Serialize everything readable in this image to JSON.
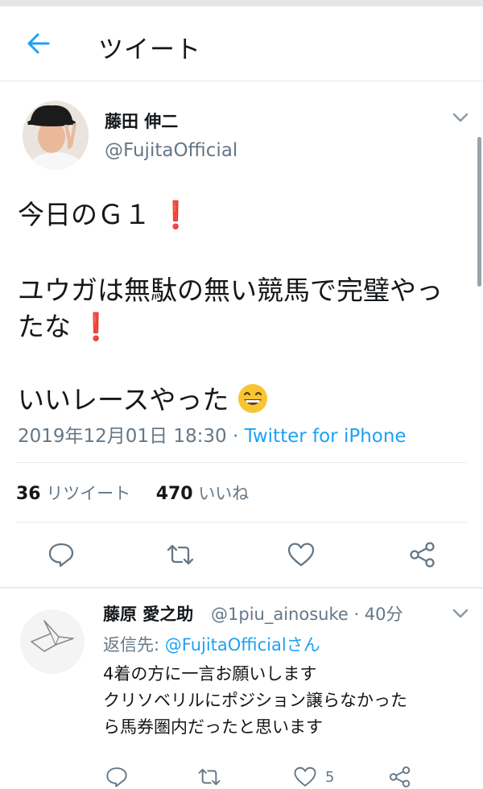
{
  "header": {
    "title": "ツイート"
  },
  "tweet": {
    "author_name": "藤田 伸二",
    "author_handle": "@FujitaOfficial",
    "lines": [
      "今日のＧ１",
      "ユウガは無駄の無い競馬で完璧やっ",
      "たな",
      "いいレースやった"
    ],
    "emoji": "😄",
    "timestamp": "2019年12月01日 18:30",
    "separator": " · ",
    "source": "Twitter for iPhone",
    "retweet_count": "36",
    "retweet_label": "リツイート",
    "like_count": "470",
    "like_label": "いいね"
  },
  "reply": {
    "author_name": "藤原 愛之助",
    "author_handle": "@1piu_ainosuke · 40分",
    "reply_to_prefix": "返信先: ",
    "reply_to_target": "@FujitaOfficialさん",
    "lines": [
      "4着の方に一言お願いします",
      "クリソベリルにポジション譲らなかった",
      "ら馬券圏内だったと思います"
    ],
    "like_count": "5"
  },
  "colors": {
    "accent": "#1da1f2",
    "text": "#14171a",
    "muted": "#657786",
    "exclamation": "#d6253b",
    "divider": "#e6ecf0"
  },
  "icons": [
    "back-arrow-icon",
    "chevron-down-icon",
    "reply-icon",
    "retweet-icon",
    "heart-icon",
    "share-icon",
    "paper-crane-icon"
  ]
}
